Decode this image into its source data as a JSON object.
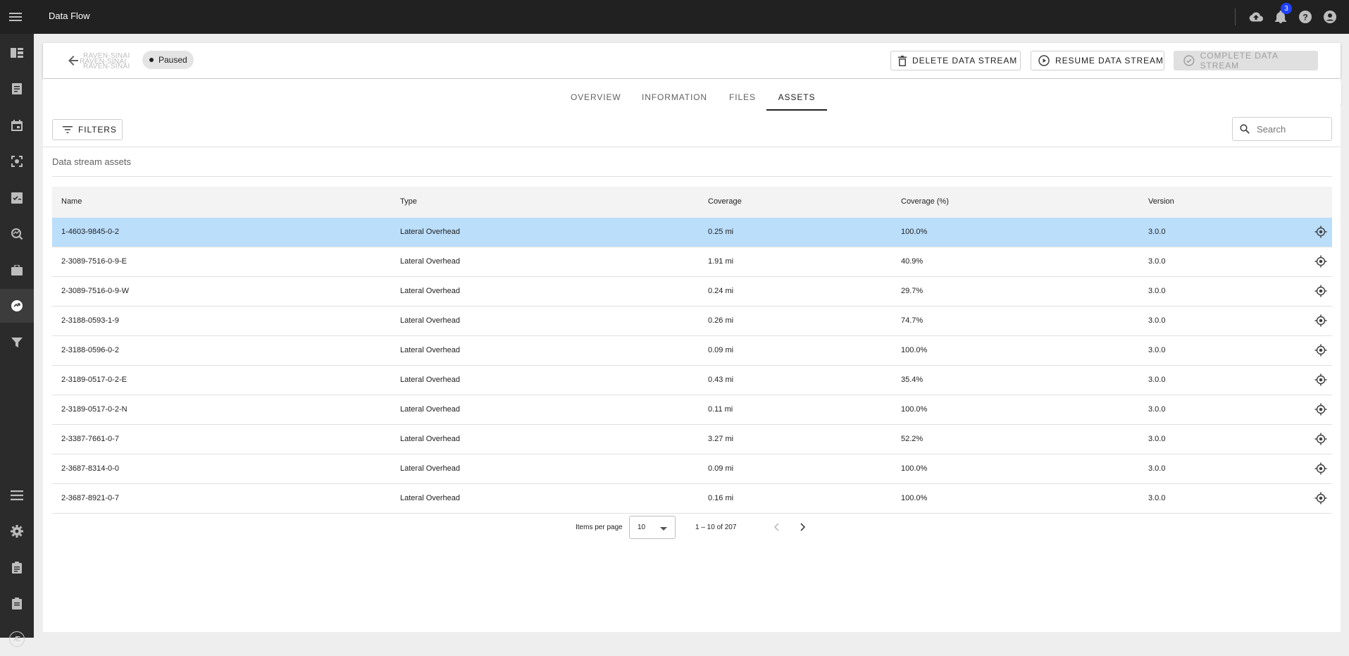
{
  "app": {
    "title": "Data Flow",
    "notification_count": "3"
  },
  "topbar": {
    "icons": [
      "menu-icon",
      "cloud-upload-icon",
      "bell-icon",
      "help-icon",
      "account-icon"
    ]
  },
  "sidenav": {
    "items": [
      "view-column-icon",
      "document-icon",
      "calendar-icon",
      "scan-icon",
      "checklist-icon",
      "map-search-icon",
      "briefcase-icon",
      "data-flow-icon",
      "filter-funnel-icon",
      "list-icon",
      "settings-icon",
      "clipboard-icon",
      "clipboard-list-icon"
    ],
    "logo": "Æ",
    "active": "data-flow-icon"
  },
  "header": {
    "stream_name_lines": [
      "RAVEN-SINAI",
      "RAVEN-SINAI",
      "RAVEN-SINAI"
    ],
    "status": "Paused",
    "delete_label": "DELETE DATA STREAM",
    "resume_label": "RESUME DATA STREAM",
    "complete_label": "COMPLETE DATA STREAM"
  },
  "tabs": [
    {
      "label": "OVERVIEW"
    },
    {
      "label": "INFORMATION"
    },
    {
      "label": "FILES"
    },
    {
      "label": "ASSETS"
    }
  ],
  "active_tab": "ASSETS",
  "toolbar": {
    "filters_label": "FILTERS",
    "search_placeholder": "Search"
  },
  "section_title": "Data stream assets",
  "table": {
    "columns": [
      "Name",
      "Type",
      "Coverage",
      "Coverage (%)",
      "Version"
    ],
    "rows": [
      {
        "name": "1-4603-9845-0-2",
        "type": "Lateral Overhead",
        "coverage": "0.25 mi",
        "coverage_pct": "100.0%",
        "version": "3.0.0",
        "selected": true
      },
      {
        "name": "2-3089-7516-0-9-E",
        "type": "Lateral Overhead",
        "coverage": "1.91 mi",
        "coverage_pct": "40.9%",
        "version": "3.0.0"
      },
      {
        "name": "2-3089-7516-0-9-W",
        "type": "Lateral Overhead",
        "coverage": "0.24 mi",
        "coverage_pct": "29.7%",
        "version": "3.0.0"
      },
      {
        "name": "2-3188-0593-1-9",
        "type": "Lateral Overhead",
        "coverage": "0.26 mi",
        "coverage_pct": "74.7%",
        "version": "3.0.0"
      },
      {
        "name": "2-3188-0596-0-2",
        "type": "Lateral Overhead",
        "coverage": "0.09 mi",
        "coverage_pct": "100.0%",
        "version": "3.0.0"
      },
      {
        "name": "2-3189-0517-0-2-E",
        "type": "Lateral Overhead",
        "coverage": "0.43 mi",
        "coverage_pct": "35.4%",
        "version": "3.0.0"
      },
      {
        "name": "2-3189-0517-0-2-N",
        "type": "Lateral Overhead",
        "coverage": "0.11 mi",
        "coverage_pct": "100.0%",
        "version": "3.0.0"
      },
      {
        "name": "2-3387-7661-0-7",
        "type": "Lateral Overhead",
        "coverage": "3.27 mi",
        "coverage_pct": "52.2%",
        "version": "3.0.0"
      },
      {
        "name": "2-3687-8314-0-0",
        "type": "Lateral Overhead",
        "coverage": "0.09 mi",
        "coverage_pct": "100.0%",
        "version": "3.0.0"
      },
      {
        "name": "2-3687-8921-0-7",
        "type": "Lateral Overhead",
        "coverage": "0.16 mi",
        "coverage_pct": "100.0%",
        "version": "3.0.0"
      }
    ]
  },
  "paginator": {
    "items_per_page_label": "Items per page",
    "page_size": "10",
    "range_label": "1 – 10 of 207"
  },
  "colors": {
    "topbar": "#212121",
    "sidenav": "#2b2b2b",
    "selected_row": "#bbdefb",
    "badge": "#1e40ff"
  }
}
